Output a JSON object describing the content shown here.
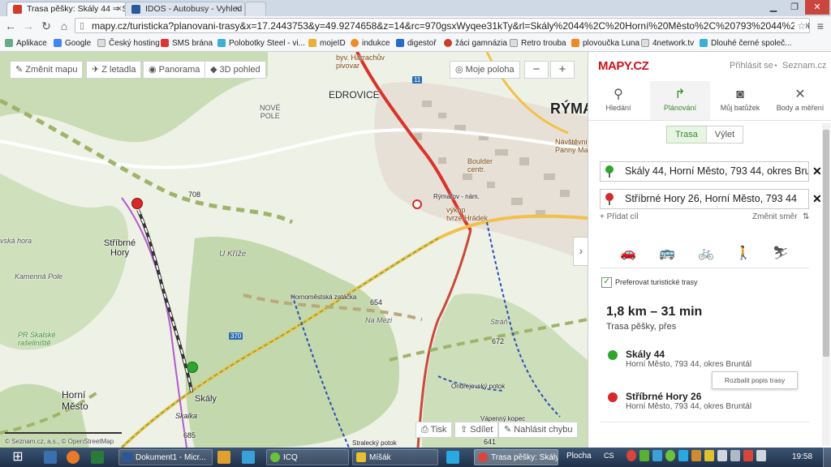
{
  "browser": {
    "tabs": [
      {
        "title": "Trasa pěšky: Skály 44 ⇒ S",
        "active": true
      },
      {
        "title": "IDOS - Autobusy - Vyhled",
        "active": false
      }
    ],
    "url": "mapy.cz/turisticka?planovani-trasy&x=17.2443753&y=49.9274658&z=14&rc=970gsxWyqee31kTy&rl=Skály%2044%2C%20Horní%20Město%2C%20793%2044%2C%",
    "bookmarks": [
      "Aplikace",
      "Google",
      "Český hosting",
      "SMS brána",
      "Polobotky Steel - vi...",
      "mojeID",
      "indukce",
      "digestoř",
      "žáci gamnázia",
      "Retro trouba",
      "plovoučka Luna",
      "4network.tv",
      "Dlouhé černé společ..."
    ]
  },
  "map": {
    "top_controls": {
      "change_map": "Změnit mapu",
      "aerial": "Z letadla",
      "panorama": "Panorama",
      "view3d": "3D pohled",
      "my_location": "Moje poloha",
      "zoom_out": "−",
      "zoom_in": "+"
    },
    "labels": {
      "edrovice": "EDROVICE",
      "ryma": "RÝMA",
      "nove_pole": "NOVÉ\nPOLE",
      "stribrne_hory": "Stříbrné\nHory",
      "horni_mesto": "Horní\nMěsto",
      "skaly": "Skály",
      "u_krize": "U Kříže",
      "kamenna_pole": "Kamenná Pole",
      "vska_hora": "vská hora",
      "pr_skalske": "PR Skalské\nrašeliniště",
      "hornomestska": "Hornoměstská zatáčka",
      "na_mezi": "Na Mezi",
      "stran": "Stráň",
      "ondrejovsky": "Ondřejovský potok",
      "vapenny_kopec": "Vápenný kopec",
      "stralecky": "Stralecký potok",
      "skalka": "Skalka",
      "harrachuv": "byv. Harrachův\npivovar",
      "boulder": "Boulder\ncentr.",
      "vykop": "výkop\ntvrze Hrádek",
      "rymarov_nam": "Rýmařov - nám.",
      "navstevnicke": "Návštěvnick\nPanny Ma",
      "elev_708": "708",
      "elev_654": "654",
      "elev_672": "672",
      "elev_685": "685",
      "elev_641": "641",
      "road_370": "370",
      "road_11": "11",
      "copyright": "© Seznam.cz, a.s., © OpenStreetMap"
    },
    "bottom_controls": {
      "print": "Tisk",
      "share": "Sdílet",
      "report": "Nahlásit chybu"
    }
  },
  "panel": {
    "logo": "MAPY.CZ",
    "login": "Přihlásit se",
    "seznam": "Seznam.cz",
    "tabs": [
      {
        "label": "Hledání",
        "icon": "search-icon"
      },
      {
        "label": "Plánování",
        "icon": "route-icon"
      },
      {
        "label": "Můj batůžek",
        "icon": "backpack-icon"
      },
      {
        "label": "Body a měření",
        "icon": "measure-icon"
      }
    ],
    "mode_trasa": "Trasa",
    "mode_vylet": "Výlet",
    "from": "Skály 44, Horní Město, 793 44, okres Bruntál",
    "to": "Stříbrné Hory 26, Horní Město, 793 44",
    "add_stop": "+ Přidat cíl",
    "reverse": "Změnit směr",
    "prefer_tourist": "Preferovat turistické trasy",
    "summary": "1,8 km – 31 min",
    "summary_sub": "Trasa pěšky, přes",
    "start_title": "Skály 44",
    "start_sub": "Horní Město, 793 44, okres Bruntál",
    "end_title": "Stříbrné Hory 26",
    "end_sub": "Horní Město, 793 44, okres Bruntál",
    "expand_desc": "Rozbalit popis trasy"
  },
  "taskbar": {
    "items": [
      {
        "label": "Dokument1 - Micr...",
        "active": false
      },
      {
        "label": "ICQ",
        "active": false
      },
      {
        "label": "Míšák",
        "active": false
      },
      {
        "label": "Trasa pěšky: Skály ...",
        "active": true
      }
    ],
    "desktop": "Plocha",
    "lang": "CS",
    "time": "19:58"
  }
}
